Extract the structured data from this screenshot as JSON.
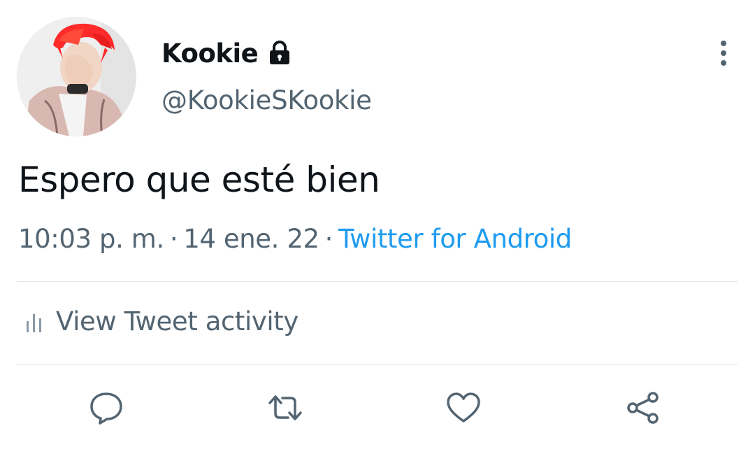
{
  "user": {
    "display_name": "Kookie",
    "handle": "@KookieSKookie",
    "avatar": "profile-photo",
    "protected_icon": "lock-icon"
  },
  "tweet": {
    "text": "Espero que esté bien",
    "time": "10:03 p. m.",
    "separator": "·",
    "date": "14 ene. 22",
    "source": "Twitter for Android"
  },
  "activity": {
    "icon": "bar-chart-icon",
    "label": "View Tweet activity"
  },
  "actions": [
    {
      "icon": "reply-icon"
    },
    {
      "icon": "retweet-icon"
    },
    {
      "icon": "like-icon"
    },
    {
      "icon": "share-icon"
    }
  ],
  "colors": {
    "text": "#0f1419",
    "secondary": "#536471",
    "link": "#1d9bf0",
    "divider": "#e1e6ea"
  }
}
